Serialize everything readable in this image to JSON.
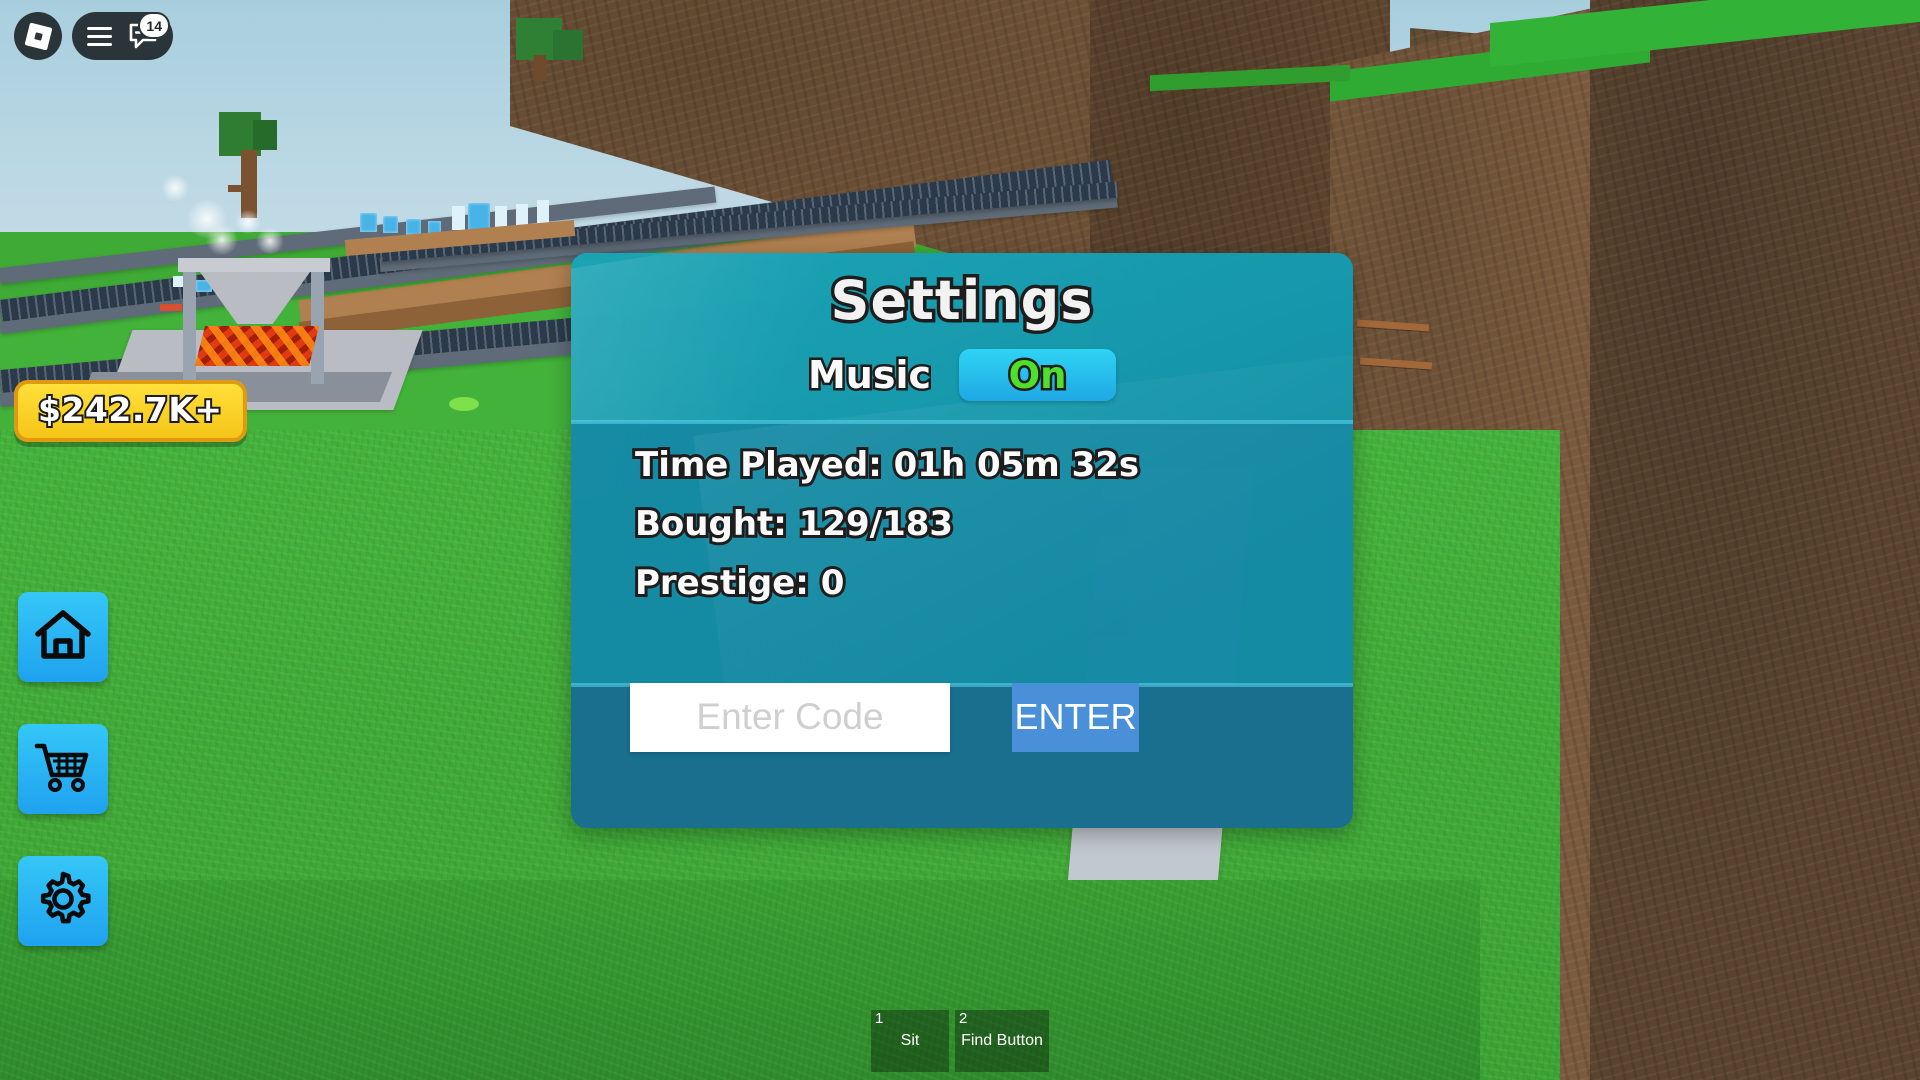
{
  "game": {
    "currency_display": "$242.7K+",
    "chat_badge_count": "14"
  },
  "topbar": {
    "logo_icon": "roblox-logo-icon",
    "menu_icon": "hamburger-menu-icon",
    "chat_icon": "chat-bubble-icon"
  },
  "side_buttons": [
    {
      "id": "home",
      "icon": "home-icon",
      "label": "Home"
    },
    {
      "id": "shop",
      "icon": "shopping-cart-icon",
      "label": "Shop"
    },
    {
      "id": "settings",
      "icon": "gear-icon",
      "label": "Settings"
    }
  ],
  "settings_panel": {
    "title": "Settings",
    "music": {
      "label": "Music",
      "toggle_value": "On",
      "toggle_on_color": "#4ee02a",
      "toggle_bg_color": "#2fd3f4"
    },
    "stats": [
      {
        "id": "time-played",
        "text": "Time Played:  01h 05m 32s"
      },
      {
        "id": "bought",
        "text": "Bought: 129/183"
      },
      {
        "id": "prestige",
        "text": "Prestige: 0"
      }
    ],
    "code": {
      "placeholder": "Enter Code",
      "value": "",
      "submit_label": "ENTER",
      "submit_color": "#4a90d9"
    },
    "panel_color": "#1287a4"
  },
  "hotbar": [
    {
      "key": "1",
      "name": "Sit"
    },
    {
      "key": "2",
      "name": "Find Button"
    }
  ]
}
